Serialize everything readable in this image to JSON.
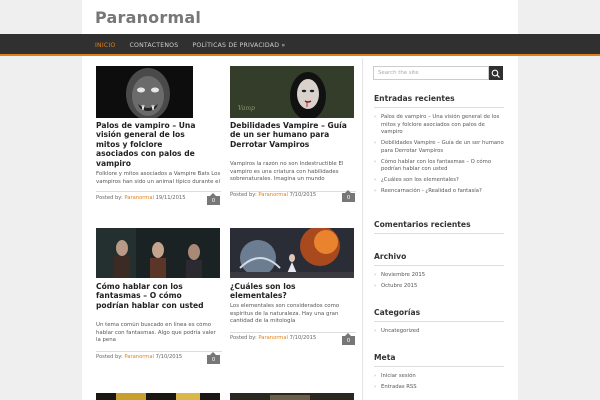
{
  "site": {
    "title": "Paranormal"
  },
  "nav": {
    "items": [
      {
        "label": "INICIO",
        "active": true
      },
      {
        "label": "CONTACTENOS",
        "active": false
      },
      {
        "label": "POLÍTICAS DE PRIVACIDAD »",
        "active": false
      }
    ]
  },
  "posts": [
    {
      "title": "Palos de vampiro – Una visión general de los mitos y folclore asociados con palos de vampiro",
      "excerpt": "Folklore y mitos asociados a Vampire Bats Los vampiros han sido un animal típico durante el",
      "posted_by": "Posted by:",
      "author": "Paranormal",
      "date": "19/11/2015",
      "comments": "0"
    },
    {
      "title": "Debilidades Vampire – Guía de un ser humano para Derrotar Vampiros",
      "excerpt": "Vampiros la razón no son Indestructible El vampiro es una criatura con habilidades sobrenaturales. Imagina un mundo",
      "posted_by": "Posted by:",
      "author": "Paranormal",
      "date": "7/10/2015",
      "comments": "0"
    },
    {
      "title": "Cómo hablar con los fantasmas – O cómo podrían hablar con usted",
      "excerpt": "Un tema común buscado en línea es cómo hablar con fantasmas. Algo que podría valer la pena",
      "posted_by": "Posted by:",
      "author": "Paranormal",
      "date": "7/10/2015",
      "comments": "0"
    },
    {
      "title": "¿Cuáles son los elementales?",
      "excerpt": "Los elementales son considerados como espíritus de la naturaleza. Hay una gran cantidad de la mitología",
      "posted_by": "Posted by:",
      "author": "Paranormal",
      "date": "7/10/2015",
      "comments": "0"
    }
  ],
  "sidebar": {
    "search_placeholder": "Search the site",
    "recent_posts_title": "Entradas recientes",
    "recent_posts": [
      "Palos de vampiro – Una visión general de los mitos y folclore asociados con palos de vampiro",
      "Debilidades Vampire – Guía de un ser humano para Derrotar Vampiros",
      "Cómo hablar con los fantasmas – O cómo podrían hablar con usted",
      "¿Cuáles son los elementales?",
      "Reencarnación - ¿Realidad o fantasía?"
    ],
    "recent_comments_title": "Comentarios recientes",
    "archive_title": "Archivo",
    "archive": [
      "Noviembre 2015",
      "Octubre 2015"
    ],
    "categories_title": "Categorías",
    "categories": [
      "Uncategorized"
    ],
    "meta_title": "Meta",
    "meta": [
      "Iniciar sesión",
      "Entradas RSS"
    ]
  },
  "colors": {
    "accent": "#e0801a",
    "nav_bg": "#303030"
  }
}
